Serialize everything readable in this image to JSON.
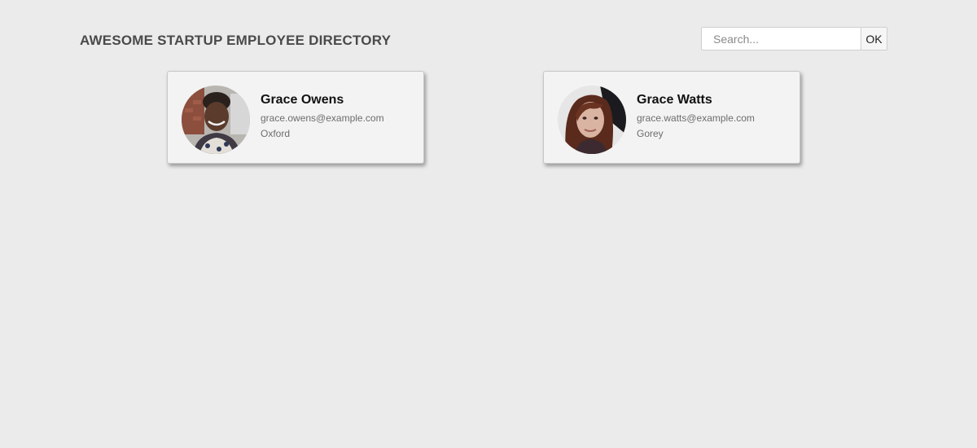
{
  "header": {
    "title": "AWESOME STARTUP EMPLOYEE DIRECTORY"
  },
  "search": {
    "placeholder": "Search...",
    "value": "",
    "button_label": "OK"
  },
  "employees": [
    {
      "name": "Grace Owens",
      "email": "grace.owens@example.com",
      "city": "Oxford",
      "avatar_icon": "user-photo"
    },
    {
      "name": "Grace Watts",
      "email": "grace.watts@example.com",
      "city": "Gorey",
      "avatar_icon": "user-photo"
    }
  ],
  "colors": {
    "background": "#ebebeb",
    "card_background": "#f3f3f3",
    "title_text": "#4a4a4a",
    "secondary_text": "#6d6d6d"
  }
}
